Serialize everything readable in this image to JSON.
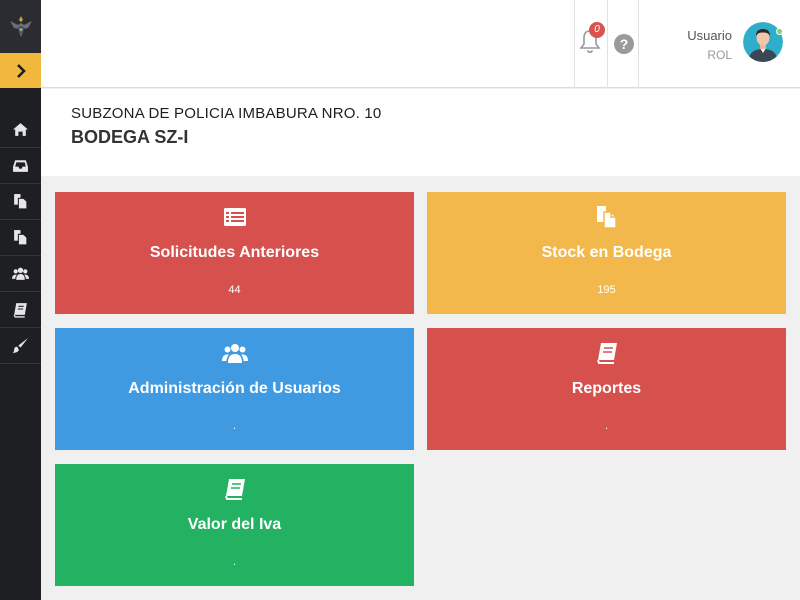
{
  "topbar": {
    "notification_count": "0",
    "help_glyph": "?",
    "user_name": "Usuario",
    "user_role": "ROL"
  },
  "header": {
    "subtitle": "SUBZONA DE POLICIA IMBABURA NRO. 10",
    "title": "BODEGA SZ-I"
  },
  "sidebar": {
    "items": [
      {
        "icon": "home-icon"
      },
      {
        "icon": "inbox-icon"
      },
      {
        "icon": "files-icon"
      },
      {
        "icon": "files-icon"
      },
      {
        "icon": "users-icon"
      },
      {
        "icon": "book-icon"
      },
      {
        "icon": "brush-icon"
      }
    ]
  },
  "cards": [
    {
      "label": "Solicitudes Anteriores",
      "count": "44",
      "color": "#d6504d",
      "icon": "list-icon"
    },
    {
      "label": "Stock en Bodega",
      "count": "195",
      "color": "#f2b84b",
      "icon": "files-icon"
    },
    {
      "label": "Administración de Usuarios",
      "count": ".",
      "color": "#3f9ae2",
      "icon": "users-icon"
    },
    {
      "label": "Reportes",
      "count": ".",
      "color": "#d6504d",
      "icon": "book-icon"
    },
    {
      "label": "Valor del Iva",
      "count": ".",
      "color": "#22b261",
      "icon": "book-icon"
    }
  ]
}
